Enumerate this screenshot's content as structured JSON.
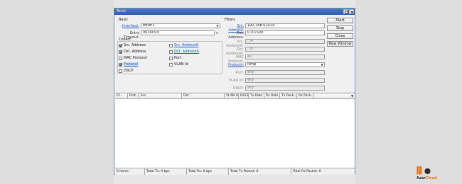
{
  "window": {
    "title": "Torch"
  },
  "basic": {
    "title": "Basic",
    "interface_label": "Interface:",
    "interface_value": "ether1",
    "entry_timeout_label": "Entry Timeout:",
    "entry_timeout_value": "00:00:03",
    "entry_timeout_unit": "s"
  },
  "collect": {
    "title": "Collect",
    "items": [
      {
        "label": "Src. Address",
        "checked": true
      },
      {
        "label": "Dst. Address",
        "checked": true
      },
      {
        "label": "MAC Protocol",
        "checked": false
      },
      {
        "label": "Protocol",
        "checked": true
      },
      {
        "label": "DSCP",
        "checked": false
      },
      {
        "label": "Src. Address6",
        "checked": false
      },
      {
        "label": "Dst. Address6",
        "checked": false
      },
      {
        "label": "Port",
        "checked": false
      },
      {
        "label": "VLAN Id",
        "checked": false
      }
    ]
  },
  "filters": {
    "title": "Filters",
    "src_address_label": "Src. Address:",
    "src_address_value": "192.168.0.0/24",
    "dst_address_label": "Dst. Address:",
    "dst_address_value": "0.0.0.0/0",
    "src_address6_label": "Src. Address6:",
    "src_address6_value": "::/0",
    "dst_address6_label": "Dst. Address6:",
    "dst_address6_value": "::/0",
    "mac_protocol_label": "MAC Protocol:",
    "mac_protocol_value": "all",
    "protocol_label": "Protocol:",
    "protocol_value": "icmp",
    "port_label": "Port:",
    "port_value": "any",
    "vlan_label": "VLAN Id:",
    "vlan_value": "any",
    "dscp_label": "DSCP:",
    "dscp_value": "any"
  },
  "buttons": {
    "start": "Start",
    "stop": "Stop",
    "close": "Close",
    "new_window": "New Window"
  },
  "table": {
    "columns": [
      "Et...",
      "Prot...",
      "Src.",
      "Dst.",
      "VLAN Id",
      "DSCP",
      "Tx Rate",
      "Rx Rate",
      "Tx Pack...",
      "Rx Pack..."
    ]
  },
  "status": {
    "items": "0 items",
    "total_tx": "Total Tx: 0 bps",
    "total_rx": "Total Rx: 0 bps",
    "total_tx_packet": "Total Tx Packet: 0",
    "total_rx_packet": "Total Rx Packet: 0"
  },
  "brand": {
    "text": "AzarCloud",
    "accent": "#e8741a",
    "dark": "#2a2a2a"
  },
  "colors": {
    "titlebar": "#2f5ba9",
    "link": "#1d55c6"
  }
}
